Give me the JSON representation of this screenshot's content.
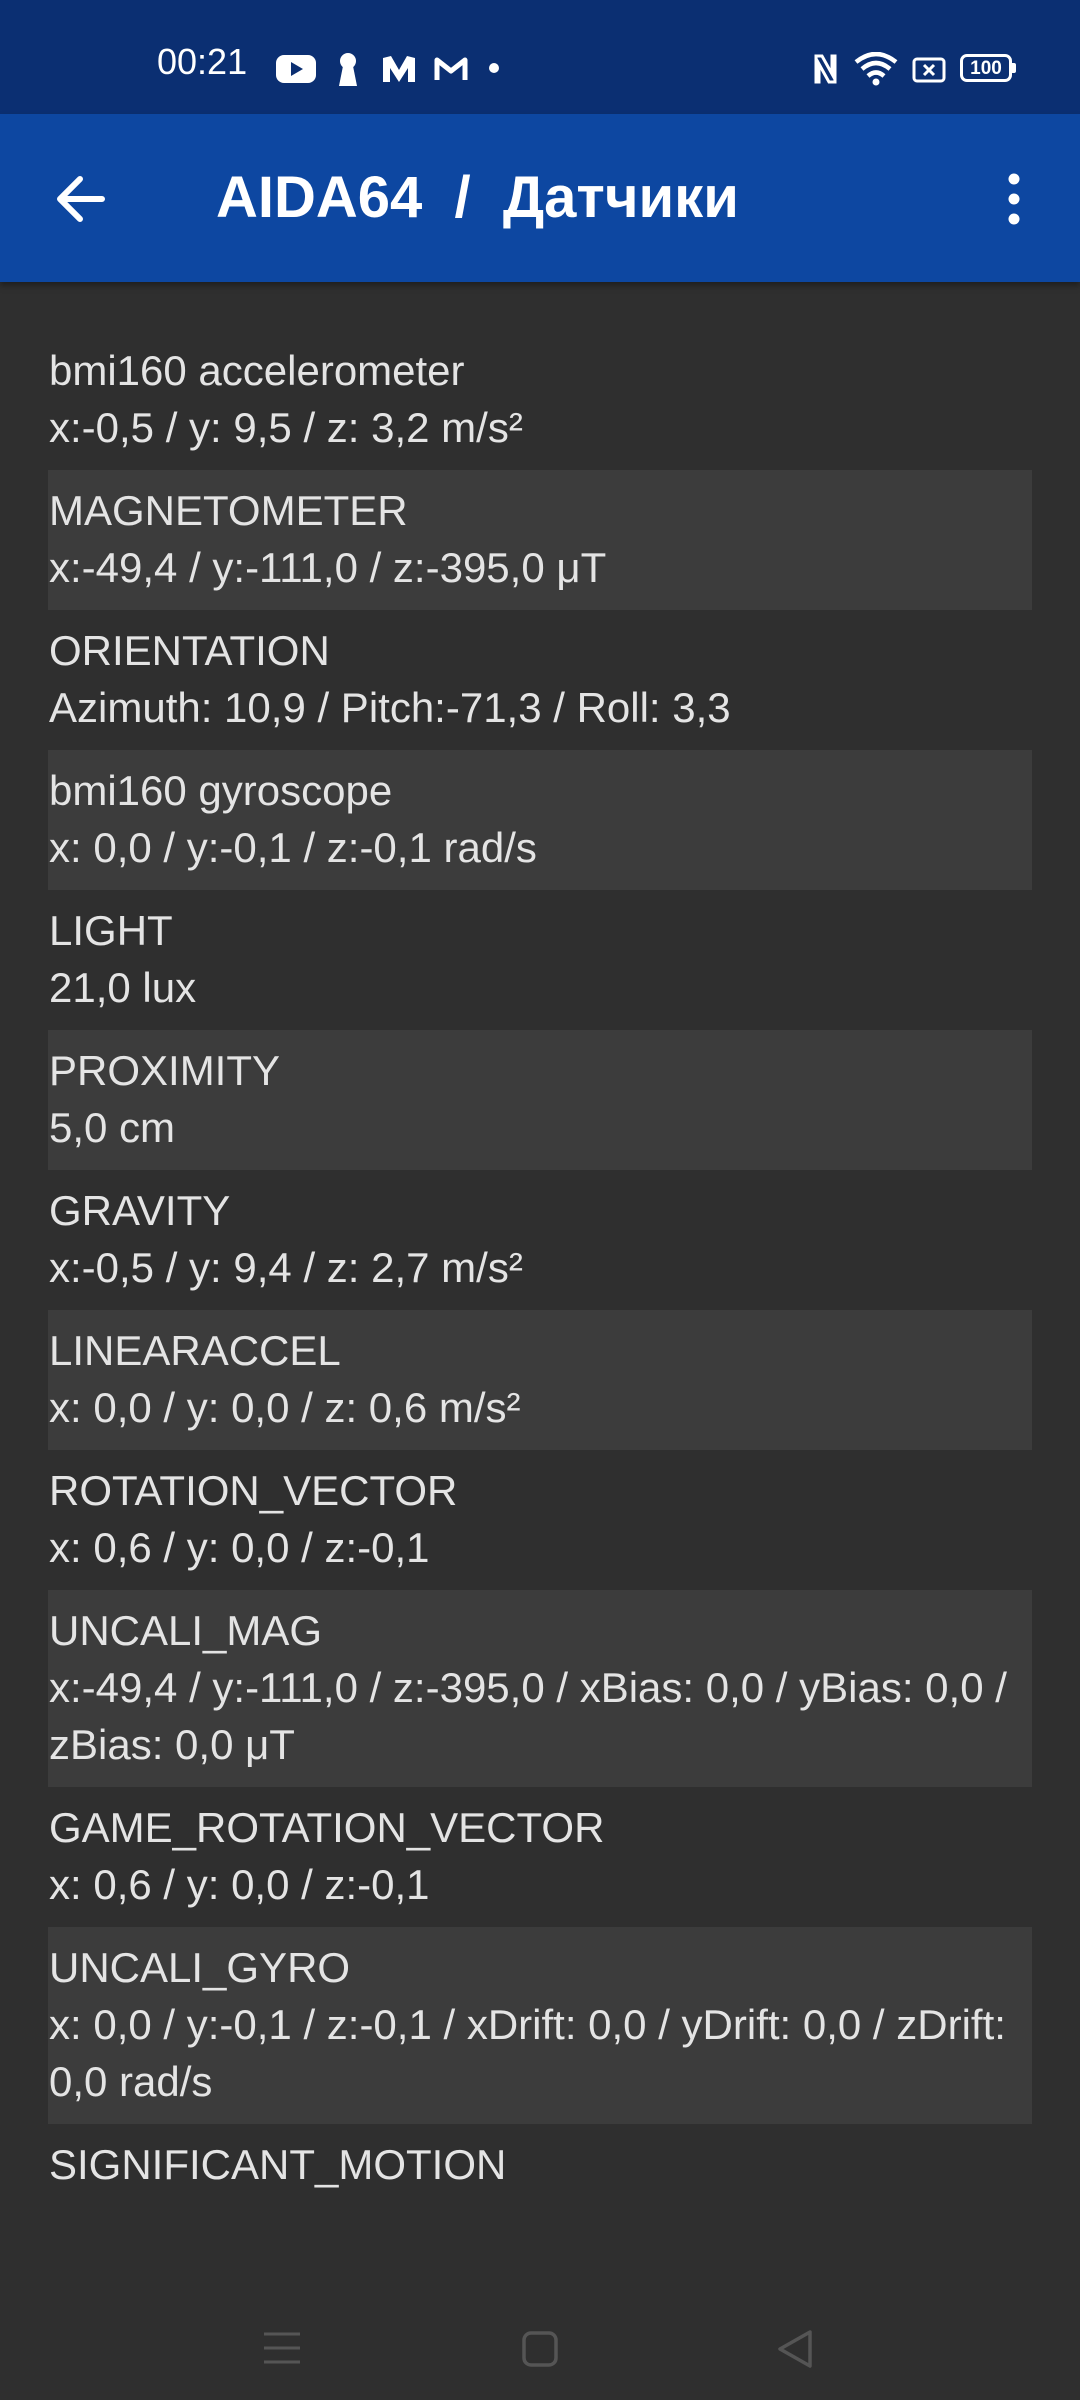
{
  "status_bar": {
    "time": "00:21",
    "left_icons": [
      "youtube-icon",
      "keyhole-icon",
      "m-logo-icon",
      "gmail-icon",
      "dot-icon"
    ],
    "right_icons": [
      "nfc-icon",
      "wifi-icon",
      "sim-icon"
    ],
    "battery_level": "100"
  },
  "app_bar": {
    "title": "AIDA64  /  Датчики"
  },
  "sensors": [
    {
      "name": "bmi160 accelerometer",
      "value": "x:-0,5 / y: 9,5 / z: 3,2 m/s²"
    },
    {
      "name": "MAGNETOMETER",
      "value": "x:-49,4 / y:-111,0 / z:-395,0 μT"
    },
    {
      "name": "ORIENTATION",
      "value": "Azimuth: 10,9 / Pitch:-71,3 / Roll: 3,3"
    },
    {
      "name": "bmi160 gyroscope",
      "value": "x: 0,0 / y:-0,1 / z:-0,1 rad/s"
    },
    {
      "name": "LIGHT",
      "value": "21,0 lux"
    },
    {
      "name": "PROXIMITY",
      "value": "5,0 cm"
    },
    {
      "name": "GRAVITY",
      "value": "x:-0,5 / y: 9,4 / z: 2,7 m/s²"
    },
    {
      "name": "LINEARACCEL",
      "value": "x: 0,0 / y: 0,0 / z: 0,6 m/s²"
    },
    {
      "name": "ROTATION_VECTOR",
      "value": "x: 0,6 / y: 0,0 / z:-0,1"
    },
    {
      "name": "UNCALI_MAG",
      "value": "x:-49,4 / y:-111,0 / z:-395,0 / xBias: 0,0 / yBias: 0,0 / zBias: 0,0 μT"
    },
    {
      "name": "GAME_ROTATION_VECTOR",
      "value": "x: 0,6 / y: 0,0 / z:-0,1"
    },
    {
      "name": "UNCALI_GYRO",
      "value": "x: 0,0 / y:-0,1 / z:-0,1 / xDrift: 0,0 / yDrift: 0,0 / zDrift: 0,0 rad/s"
    },
    {
      "name": "SIGNIFICANT_MOTION",
      "value": ""
    }
  ],
  "colors": {
    "status_bar": "#0b2f72",
    "app_bar": "#0d47a1",
    "background": "#2f2f2f",
    "alt_row": "#3c3c3c"
  }
}
